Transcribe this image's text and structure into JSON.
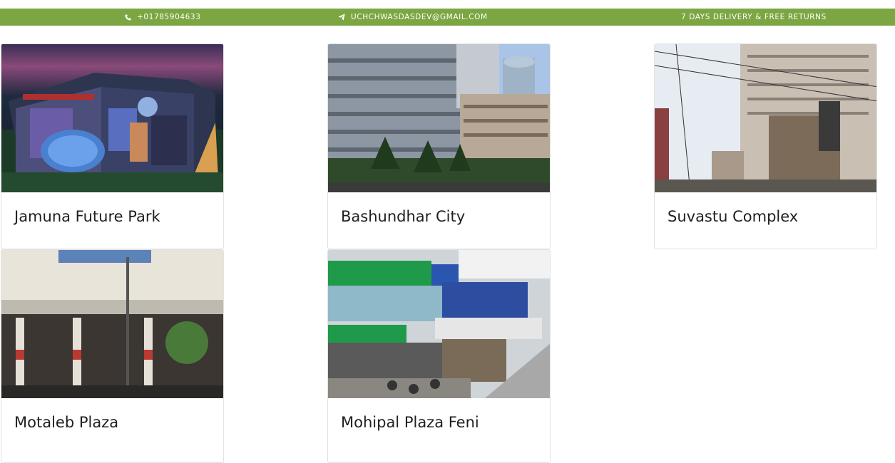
{
  "topbar": {
    "phone": "+01785904633",
    "email": "UCHCHWASDASDEV@GMAIL.COM",
    "delivery": "7 DAYS DELIVERY & FREE RETURNS",
    "bg_color": "#7ba642"
  },
  "stores": [
    {
      "name": "Jamuna Future Park"
    },
    {
      "name": "Bashundhar City"
    },
    {
      "name": "Suvastu Complex"
    },
    {
      "name": "Motaleb Plaza"
    },
    {
      "name": "Mohipal Plaza Feni"
    }
  ]
}
